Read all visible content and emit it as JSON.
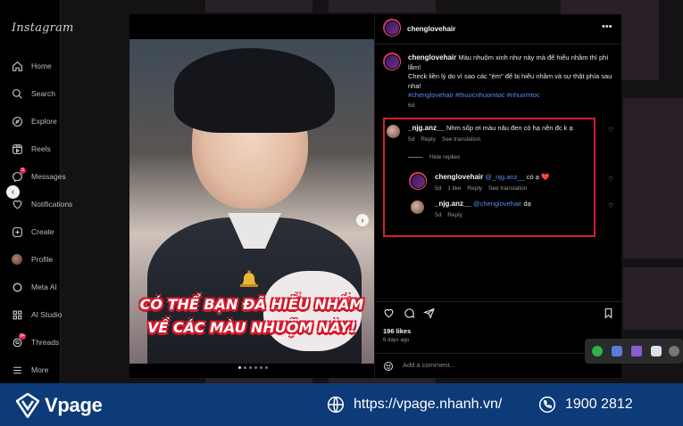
{
  "app": {
    "name": "Instagram"
  },
  "sidebar": {
    "items": [
      {
        "label": "Home",
        "icon": "home-icon"
      },
      {
        "label": "Search",
        "icon": "search-icon"
      },
      {
        "label": "Explore",
        "icon": "compass-icon"
      },
      {
        "label": "Reels",
        "icon": "reels-icon"
      },
      {
        "label": "Messages",
        "icon": "messenger-icon",
        "badge": "5"
      },
      {
        "label": "Notifications",
        "icon": "heart-icon"
      },
      {
        "label": "Create",
        "icon": "plus-square-icon"
      },
      {
        "label": "Profile",
        "icon": "avatar"
      },
      {
        "label": "Meta AI",
        "icon": "meta-ai-icon"
      },
      {
        "label": "AI Studio",
        "icon": "ai-studio-icon"
      },
      {
        "label": "Threads",
        "icon": "threads-icon",
        "badge": "9+"
      },
      {
        "label": "More",
        "icon": "menu-icon"
      }
    ]
  },
  "post": {
    "image_caption_line1": "CÓ THỂ BẠN ĐÃ HIỂU NHẦM",
    "image_caption_line2": "VỀ CÁC MÀU NHUỘM NÀY!",
    "carousel_dots": 6,
    "active_dot": 0,
    "author": "chenglovehair",
    "caption_author": "chenglovehair",
    "caption_text": "Màu nhuộm xinh như này mà để hiểu nhầm thì phí lắm!",
    "caption_line2": "Check liền lý do vì sao các \"ẻm\" để bị hiểu nhầm và sự thật phía sau nha!",
    "hashtags": "#chenglovehair #thuocnhuomtoc #nhuomtoc",
    "caption_time": "6d",
    "likes": "196 likes",
    "posted_ago": "6 days ago",
    "add_comment_placeholder": "Add a comment..."
  },
  "comments": [
    {
      "user": "_njg.anz__",
      "text": "Nhm sốp ơi màu nâu đen có hạ nền đc k ạ",
      "time": "5d",
      "reply_label": "Reply",
      "translate_label": "See translation"
    }
  ],
  "hide_replies_label": "Hide replies",
  "replies": [
    {
      "user": "chenglovehair",
      "mention": "@_njg.anz__",
      "text": "có ạ ❤️",
      "time": "5d",
      "likes": "1 like",
      "reply_label": "Reply",
      "translate_label": "See translation"
    },
    {
      "user": "_njg.anz__",
      "mention": "@chenglovehair",
      "text": "dạ",
      "time": "5d",
      "reply_label": "Reply"
    }
  ],
  "footer": {
    "brand": "Vpage",
    "url": "https://vpage.nhanh.vn/",
    "phone": "1900 2812"
  },
  "colors": {
    "highlight_box": "#d0212e",
    "link": "#5b8def",
    "footer_bg": "#0d3a78"
  }
}
